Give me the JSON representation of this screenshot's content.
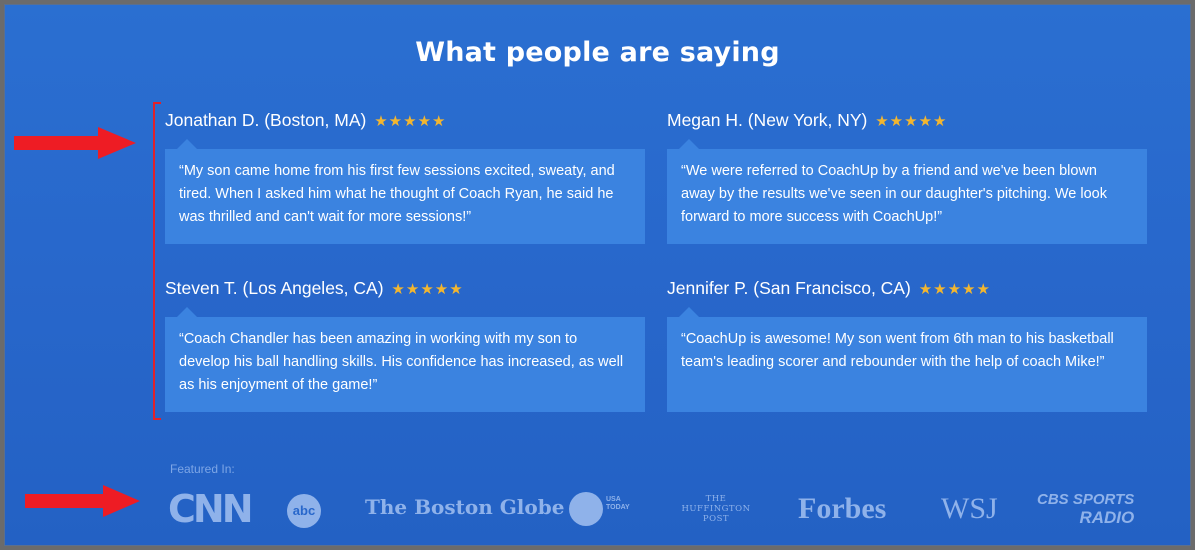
{
  "heading": "What people are saying",
  "testimonials": [
    {
      "name": "Jonathan D. (Boston, MA)",
      "stars": "★★★★★",
      "quote": "“My son came home from his first few sessions excited, sweaty, and tired. When I asked him what he thought of Coach Ryan, he said he was thrilled and can't wait for more sessions!”"
    },
    {
      "name": "Megan H. (New York, NY)",
      "stars": "★★★★★",
      "quote": "“We were referred to CoachUp by a friend and we've been blown away by the results we've seen in our daughter's pitching. We look forward to more success with CoachUp!”"
    },
    {
      "name": "Steven T. (Los Angeles, CA)",
      "stars": "★★★★★",
      "quote": "“Coach Chandler has been amazing in working with my son to develop his ball handling skills. His confidence has increased, as well as his enjoyment of the game!”"
    },
    {
      "name": "Jennifer P. (San Francisco, CA)",
      "stars": "★★★★★",
      "quote": "“CoachUp is awesome! My son went from 6th man to his basketball team's leading scorer and rebounder with the help of coach Mike!”"
    }
  ],
  "featured": {
    "label": "Featured In:",
    "logos": {
      "cnn": "CNN",
      "abc": "abc",
      "boston_globe": "The Boston Globe",
      "usa_today": "USA TODAY",
      "huffington": "THE HUFFINGTON POST",
      "forbes": "Forbes",
      "wsj": "WSJ",
      "cbs_line1": "CBS SPORTS",
      "cbs_line2": "RADIO"
    }
  },
  "colors": {
    "background": "#2867cb",
    "quote_box": "#3b83e0",
    "stars": "#f2b630",
    "annotation_red": "#e0222a",
    "logo": "#8fb2ea"
  }
}
